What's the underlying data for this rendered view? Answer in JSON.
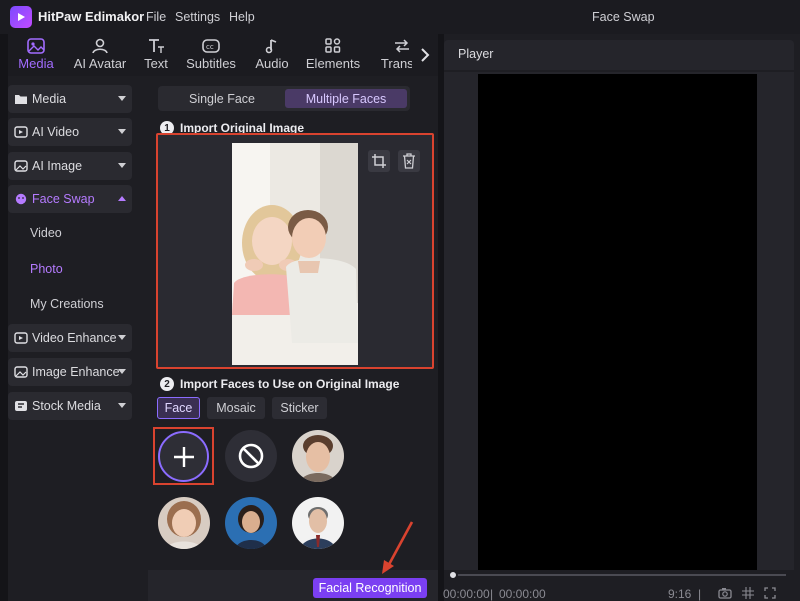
{
  "app": {
    "name": "HitPaw Edimakor",
    "window_title": "Face Swap"
  },
  "menu": [
    "File",
    "Settings",
    "Help"
  ],
  "toolbar": {
    "tabs": [
      {
        "label": "Media",
        "icon": "image-icon",
        "active": true
      },
      {
        "label": "AI Avatar",
        "icon": "avatar-icon"
      },
      {
        "label": "Text",
        "icon": "text-icon"
      },
      {
        "label": "Subtitles",
        "icon": "subtitles-icon"
      },
      {
        "label": "Audio",
        "icon": "music-note-icon"
      },
      {
        "label": "Elements",
        "icon": "elements-icon"
      },
      {
        "label": "Transiti",
        "icon": "transition-icon"
      }
    ]
  },
  "sidebar": {
    "items": [
      {
        "label": "Media"
      },
      {
        "label": "AI Video"
      },
      {
        "label": "AI Image"
      },
      {
        "label": "Face Swap",
        "expanded": true
      },
      {
        "label": "Video Enhance"
      },
      {
        "label": "Image Enhance"
      },
      {
        "label": "Stock Media"
      }
    ],
    "sub": [
      "Video",
      "Photo",
      "My Creations"
    ]
  },
  "face_swap": {
    "modes": [
      "Single Face",
      "Multiple Faces"
    ],
    "active_mode": "Multiple Faces",
    "step1": {
      "num": "1",
      "label": "Import Original Image"
    },
    "step2": {
      "num": "2",
      "label": "Import Faces to Use on Original Image"
    },
    "face_tabs": [
      "Face",
      "Mosaic",
      "Sticker"
    ],
    "active_face_tab": "Face",
    "action_button": "Facial Recognition"
  },
  "player": {
    "title": "Player",
    "time_current": "00:00:00",
    "time_total": "00:00:00",
    "aspect": "9:16"
  },
  "colors": {
    "accent": "#7b3ff2",
    "highlight": "#d9432f",
    "active_text": "#b57bff"
  }
}
